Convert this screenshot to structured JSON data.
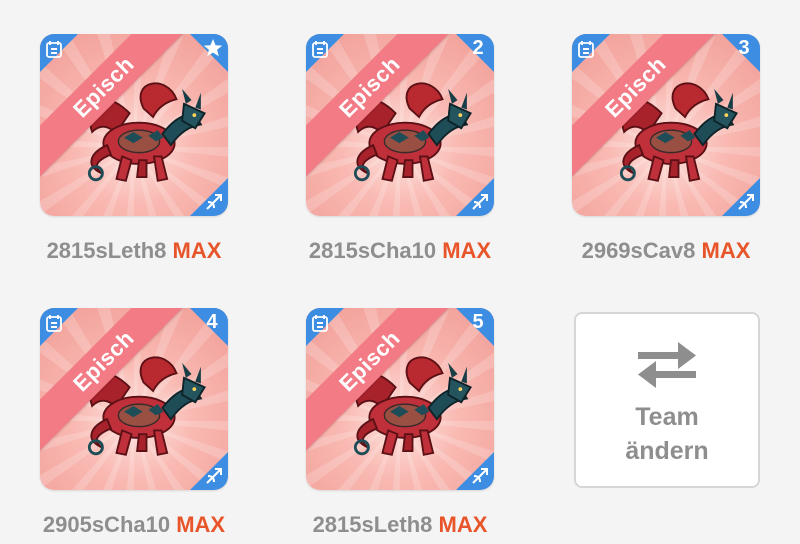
{
  "colors": {
    "rarity_ribbon": "#f27b86",
    "corner_badge": "#3d8ee2",
    "max_label": "#e8552a",
    "name_text": "#8e8e8e",
    "card_bg": "#f9b9b2"
  },
  "team": [
    {
      "rarity": "Episch",
      "slot_badge": "★",
      "slot_icon": "star-icon",
      "name": "2815sLeth8",
      "level": "MAX",
      "corner_icon": "calendar-icon",
      "class_icon": "bow-arrow-icon"
    },
    {
      "rarity": "Episch",
      "slot_badge": "2",
      "name": "2815sCha10",
      "level": "MAX",
      "corner_icon": "calendar-icon",
      "class_icon": "bow-arrow-icon"
    },
    {
      "rarity": "Episch",
      "slot_badge": "3",
      "name": "2969sCav8",
      "level": "MAX",
      "corner_icon": "calendar-icon",
      "class_icon": "bow-arrow-icon"
    },
    {
      "rarity": "Episch",
      "slot_badge": "4",
      "name": "2905sCha10",
      "level": "MAX",
      "corner_icon": "calendar-icon",
      "class_icon": "bow-arrow-icon"
    },
    {
      "rarity": "Episch",
      "slot_badge": "5",
      "name": "2815sLeth8",
      "level": "MAX",
      "corner_icon": "calendar-icon",
      "class_icon": "bow-arrow-icon"
    }
  ],
  "change_team": {
    "icon": "swap-arrows-icon",
    "line1": "Team",
    "line2": "ändern"
  }
}
